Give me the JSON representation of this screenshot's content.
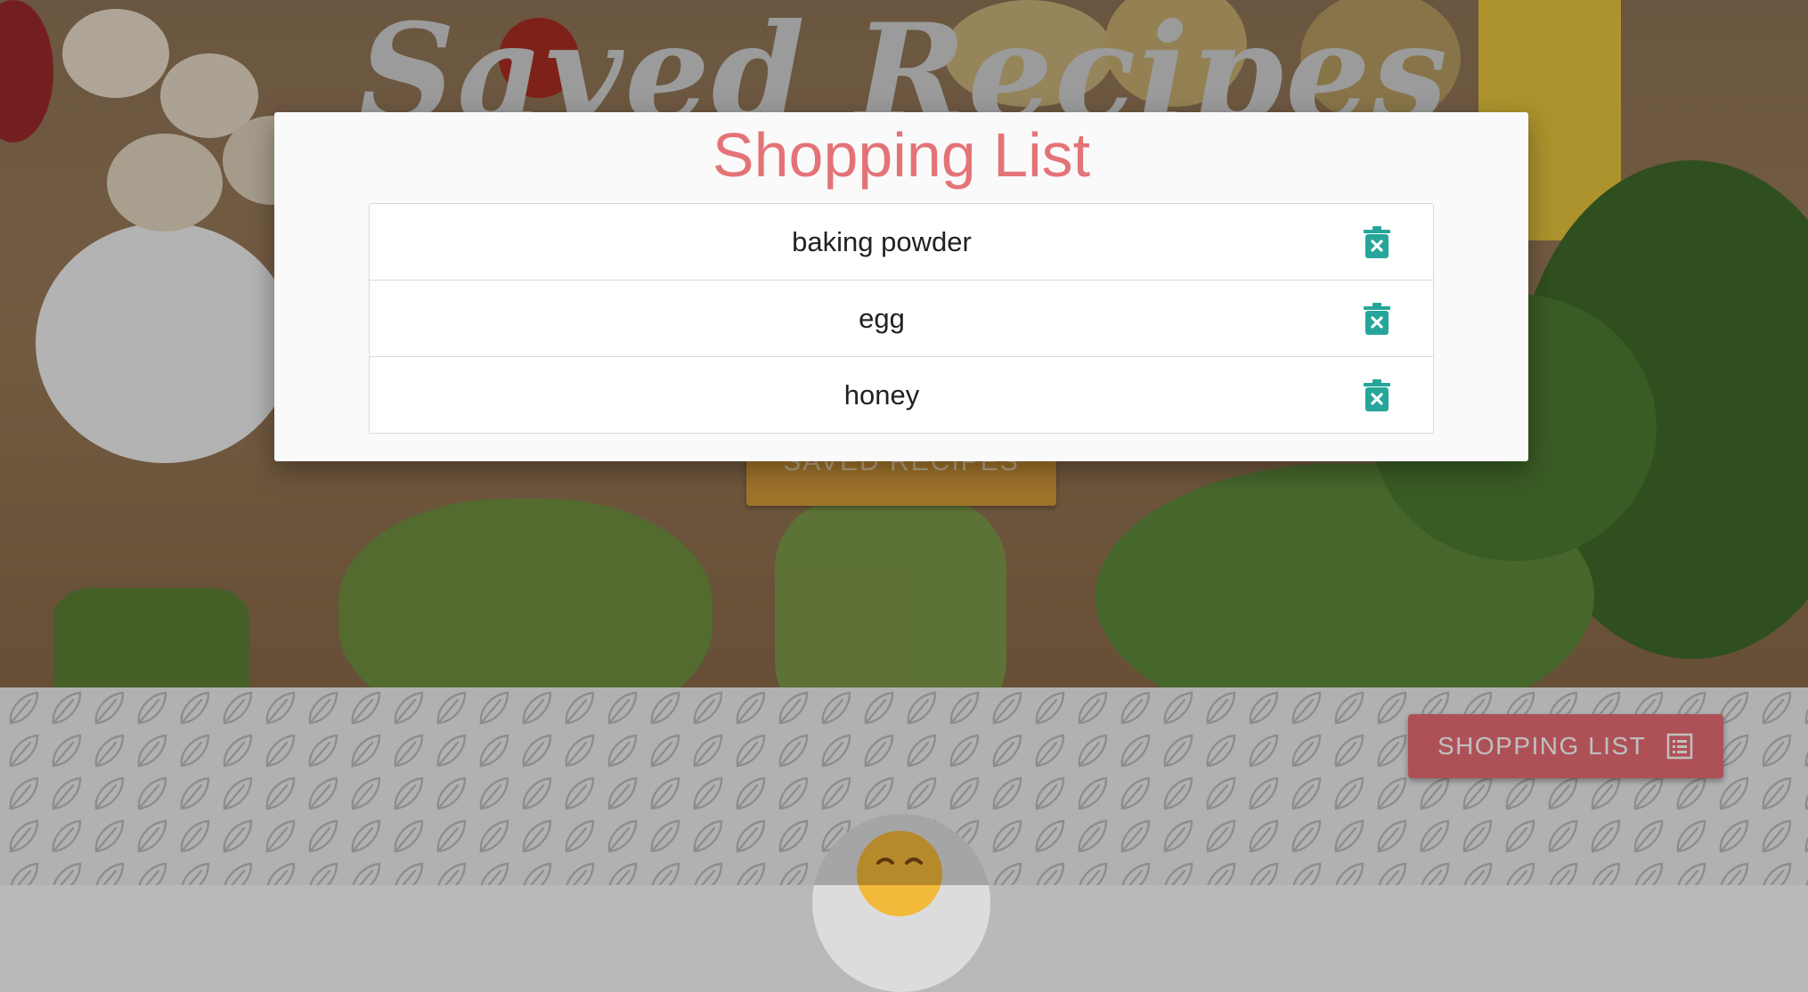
{
  "hero": {
    "title": "Saved Recipes",
    "button_label": "SAVED RECIPES"
  },
  "modal": {
    "title": "Shopping List",
    "items": [
      {
        "name": "baking powder",
        "icon": "trash-delete-icon"
      },
      {
        "name": "egg",
        "icon": "trash-delete-icon"
      },
      {
        "name": "honey",
        "icon": "trash-delete-icon"
      }
    ]
  },
  "fab": {
    "label": "SHOPPING LIST",
    "icon": "list-icon"
  },
  "colors": {
    "accent": "#e47377",
    "button_pink": "#e96d74",
    "delete_teal": "#26a69a",
    "hero_button": "#d69a3a"
  }
}
